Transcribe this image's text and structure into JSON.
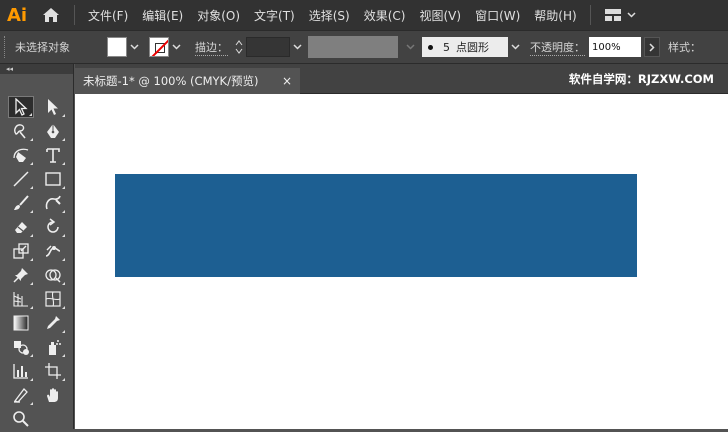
{
  "app": {
    "logo": "Ai"
  },
  "menu": {
    "items": [
      "文件(F)",
      "编辑(E)",
      "对象(O)",
      "文字(T)",
      "选择(S)",
      "效果(C)",
      "视图(V)",
      "窗口(W)",
      "帮助(H)"
    ]
  },
  "control": {
    "no_selection": "未选择对象",
    "stroke_label": "描边：",
    "brush_size": "5",
    "brush_name": "点圆形",
    "opacity_label": "不透明度：",
    "opacity_value": "100%",
    "style_label": "样式："
  },
  "document": {
    "tab_title": "未标题-1* @ 100% (CMYK/预览)",
    "close_glyph": "×",
    "watermark": "软件自学网：RJZXW.COM"
  },
  "toolbox": {
    "collapse_glyph": "◂◂"
  },
  "colors": {
    "rect_fill": "#1d5f92",
    "menubar": "#323232",
    "panel": "#535353",
    "logo": "#ff9a00"
  },
  "tools": [
    "selection-tool",
    "direct-selection-tool",
    "magic-wand-tool",
    "pen-tool",
    "curvature-tool",
    "type-tool",
    "line-segment-tool",
    "rectangle-tool",
    "paintbrush-tool",
    "shaper-tool",
    "eraser-tool",
    "rotate-tool",
    "scale-tool",
    "puppet-warp-tool",
    "pin-tool",
    "shape-builder-tool",
    "perspective-grid-tool",
    "mesh-tool",
    "gradient-tool",
    "eyedropper-tool",
    "blend-tool",
    "symbol-sprayer-tool",
    "column-graph-tool",
    "artboard-tool",
    "slice-tool",
    "hand-tool",
    "zoom-tool"
  ]
}
